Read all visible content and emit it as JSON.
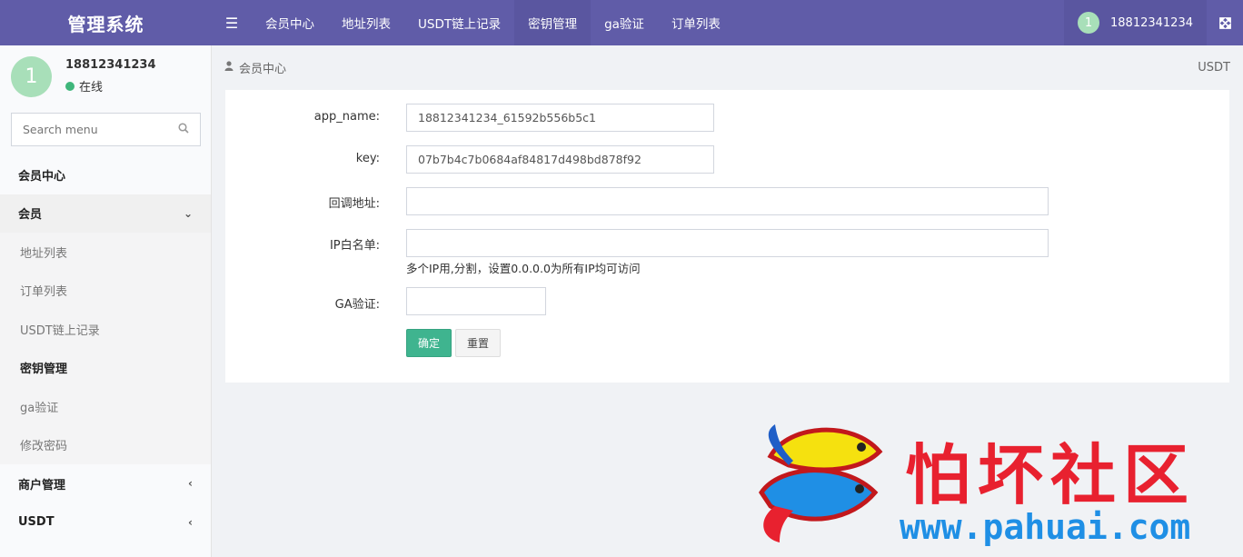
{
  "header": {
    "brand": "管理系统",
    "menu_icon": "bars-icon",
    "nav": [
      {
        "label": "会员中心"
      },
      {
        "label": "地址列表"
      },
      {
        "label": "USDT链上记录"
      },
      {
        "label": "密钥管理"
      },
      {
        "label": "ga验证"
      },
      {
        "label": "订单列表"
      }
    ],
    "user": {
      "avatar_letter": "1",
      "name": "18812341234"
    },
    "expand_icon": "expand-icon"
  },
  "sidebar": {
    "user": {
      "avatar_letter": "1",
      "name": "18812341234",
      "status": "在线",
      "status_color": "#3fb67b"
    },
    "search_placeholder": "Search menu",
    "items": [
      {
        "label": "会员中心"
      },
      {
        "label": "会员"
      },
      {
        "label": "地址列表"
      },
      {
        "label": "订单列表"
      },
      {
        "label": "USDT链上记录"
      },
      {
        "label": "密钥管理"
      },
      {
        "label": "ga验证"
      },
      {
        "label": "修改密码"
      },
      {
        "label": "商户管理"
      },
      {
        "label": "USDT"
      }
    ]
  },
  "breadcrumb": {
    "current": "会员中心",
    "right": "USDT"
  },
  "form": {
    "app_name_label": "app_name:",
    "app_name_value": "18812341234_61592b556b5c1",
    "key_label": "key:",
    "key_value": "07b7b4c7b0684af84817d498bd878f92",
    "callback_label": "回调地址:",
    "callback_value": "",
    "ip_label": "IP白名单:",
    "ip_value": "",
    "ip_help": "多个IP用,分割，设置0.0.0.0为所有IP均可访问",
    "ga_label": "GA验证:",
    "ga_value": "",
    "submit": "确定",
    "reset": "重置"
  },
  "watermark": {
    "title": "怕坏社区",
    "url": "www.pahuai.com"
  },
  "colors": {
    "header": "#605ca8",
    "primary_button": "#3fb48f",
    "watermark_red": "#e8212f",
    "watermark_blue": "#1f8fe5"
  }
}
